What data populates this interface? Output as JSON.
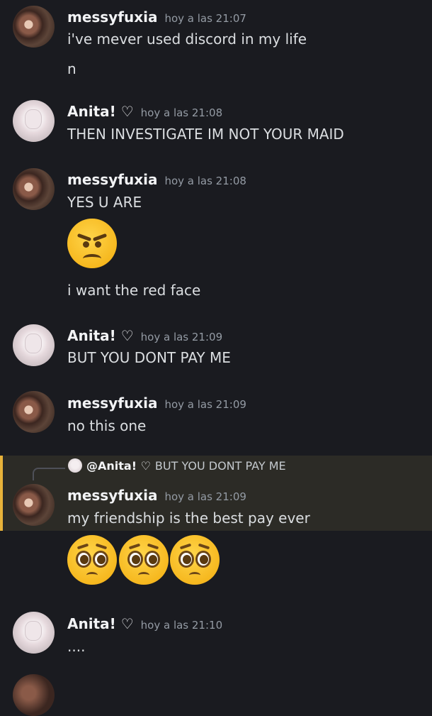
{
  "messages": [
    {
      "author": "messyfuxia",
      "time": "hoy a las 21:07",
      "lines": [
        "i've mever used discord in my life",
        "n"
      ]
    },
    {
      "author": "Anita! ♡",
      "time": "hoy a las 21:08",
      "lines": [
        "THEN INVESTIGATE IM NOT YOUR MAID"
      ]
    },
    {
      "author": "messyfuxia",
      "time": "hoy a las 21:08",
      "lines": [
        "YES U ARE",
        "i want the red face"
      ]
    },
    {
      "author": "Anita! ♡",
      "time": "hoy a las 21:09",
      "lines": [
        "BUT YOU DONT PAY ME"
      ]
    },
    {
      "author": "messyfuxia",
      "time": "hoy a las 21:09",
      "lines": [
        "no this one"
      ]
    },
    {
      "author": "messyfuxia",
      "time": "hoy a las 21:09",
      "lines": [
        "my friendship is the best pay ever"
      ],
      "reply": {
        "mention": "@Anita! ♡",
        "text": "BUT YOU DONT PAY ME"
      }
    },
    {
      "author": "Anita! ♡",
      "time": "hoy a las 21:10",
      "lines": [
        "...."
      ]
    }
  ],
  "emojis": {
    "angry": "angry-face-emoji",
    "pleading": "pleading-face-emoji"
  },
  "colors": {
    "background": "#1a1b20",
    "reply_highlight": "#2c2b26",
    "reply_bar": "#e8b23a"
  }
}
